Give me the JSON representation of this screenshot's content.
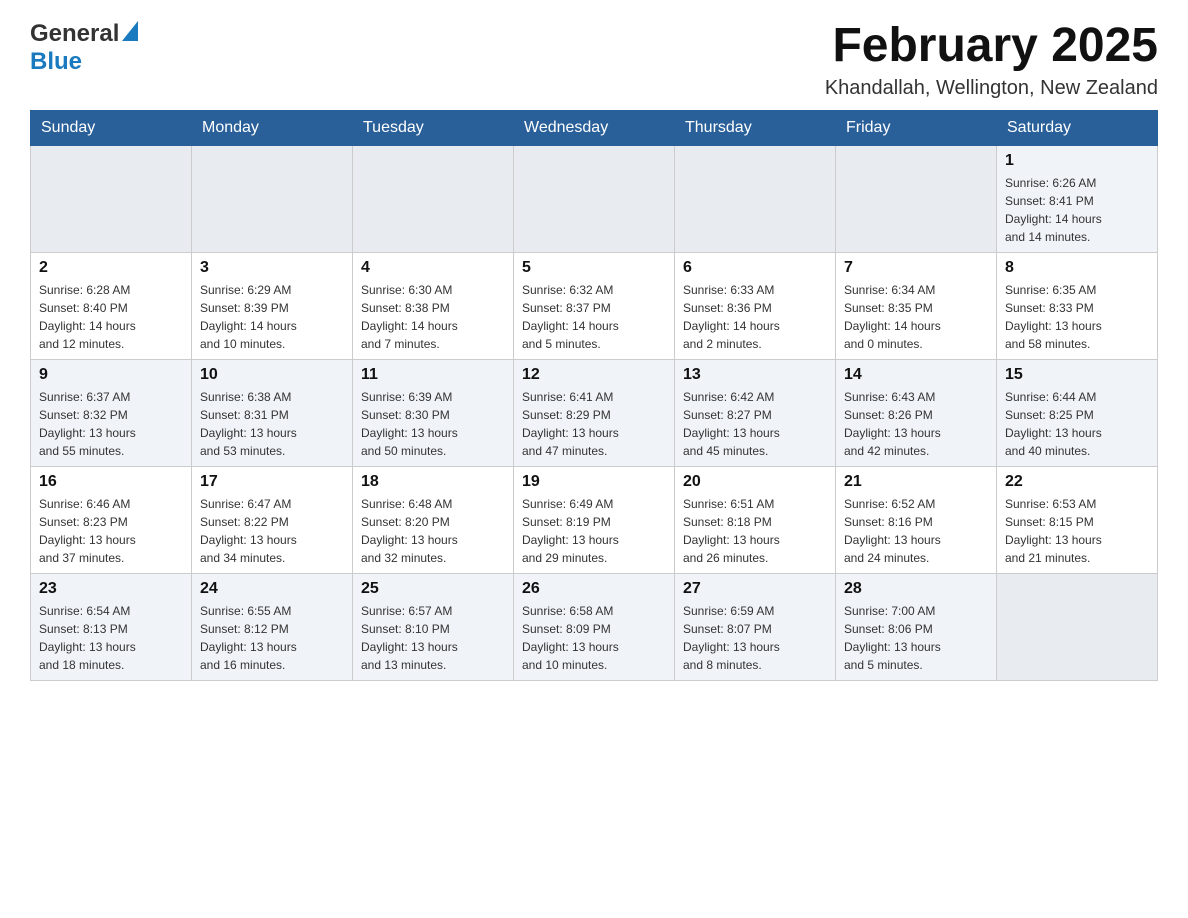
{
  "header": {
    "logo_general": "General",
    "logo_blue": "Blue",
    "title": "February 2025",
    "subtitle": "Khandallah, Wellington, New Zealand"
  },
  "days_of_week": [
    "Sunday",
    "Monday",
    "Tuesday",
    "Wednesday",
    "Thursday",
    "Friday",
    "Saturday"
  ],
  "weeks": [
    {
      "row_class": "row1",
      "days": [
        {
          "number": "",
          "info": ""
        },
        {
          "number": "",
          "info": ""
        },
        {
          "number": "",
          "info": ""
        },
        {
          "number": "",
          "info": ""
        },
        {
          "number": "",
          "info": ""
        },
        {
          "number": "",
          "info": ""
        },
        {
          "number": "1",
          "info": "Sunrise: 6:26 AM\nSunset: 8:41 PM\nDaylight: 14 hours\nand 14 minutes."
        }
      ]
    },
    {
      "row_class": "row2",
      "days": [
        {
          "number": "2",
          "info": "Sunrise: 6:28 AM\nSunset: 8:40 PM\nDaylight: 14 hours\nand 12 minutes."
        },
        {
          "number": "3",
          "info": "Sunrise: 6:29 AM\nSunset: 8:39 PM\nDaylight: 14 hours\nand 10 minutes."
        },
        {
          "number": "4",
          "info": "Sunrise: 6:30 AM\nSunset: 8:38 PM\nDaylight: 14 hours\nand 7 minutes."
        },
        {
          "number": "5",
          "info": "Sunrise: 6:32 AM\nSunset: 8:37 PM\nDaylight: 14 hours\nand 5 minutes."
        },
        {
          "number": "6",
          "info": "Sunrise: 6:33 AM\nSunset: 8:36 PM\nDaylight: 14 hours\nand 2 minutes."
        },
        {
          "number": "7",
          "info": "Sunrise: 6:34 AM\nSunset: 8:35 PM\nDaylight: 14 hours\nand 0 minutes."
        },
        {
          "number": "8",
          "info": "Sunrise: 6:35 AM\nSunset: 8:33 PM\nDaylight: 13 hours\nand 58 minutes."
        }
      ]
    },
    {
      "row_class": "row3",
      "days": [
        {
          "number": "9",
          "info": "Sunrise: 6:37 AM\nSunset: 8:32 PM\nDaylight: 13 hours\nand 55 minutes."
        },
        {
          "number": "10",
          "info": "Sunrise: 6:38 AM\nSunset: 8:31 PM\nDaylight: 13 hours\nand 53 minutes."
        },
        {
          "number": "11",
          "info": "Sunrise: 6:39 AM\nSunset: 8:30 PM\nDaylight: 13 hours\nand 50 minutes."
        },
        {
          "number": "12",
          "info": "Sunrise: 6:41 AM\nSunset: 8:29 PM\nDaylight: 13 hours\nand 47 minutes."
        },
        {
          "number": "13",
          "info": "Sunrise: 6:42 AM\nSunset: 8:27 PM\nDaylight: 13 hours\nand 45 minutes."
        },
        {
          "number": "14",
          "info": "Sunrise: 6:43 AM\nSunset: 8:26 PM\nDaylight: 13 hours\nand 42 minutes."
        },
        {
          "number": "15",
          "info": "Sunrise: 6:44 AM\nSunset: 8:25 PM\nDaylight: 13 hours\nand 40 minutes."
        }
      ]
    },
    {
      "row_class": "row4",
      "days": [
        {
          "number": "16",
          "info": "Sunrise: 6:46 AM\nSunset: 8:23 PM\nDaylight: 13 hours\nand 37 minutes."
        },
        {
          "number": "17",
          "info": "Sunrise: 6:47 AM\nSunset: 8:22 PM\nDaylight: 13 hours\nand 34 minutes."
        },
        {
          "number": "18",
          "info": "Sunrise: 6:48 AM\nSunset: 8:20 PM\nDaylight: 13 hours\nand 32 minutes."
        },
        {
          "number": "19",
          "info": "Sunrise: 6:49 AM\nSunset: 8:19 PM\nDaylight: 13 hours\nand 29 minutes."
        },
        {
          "number": "20",
          "info": "Sunrise: 6:51 AM\nSunset: 8:18 PM\nDaylight: 13 hours\nand 26 minutes."
        },
        {
          "number": "21",
          "info": "Sunrise: 6:52 AM\nSunset: 8:16 PM\nDaylight: 13 hours\nand 24 minutes."
        },
        {
          "number": "22",
          "info": "Sunrise: 6:53 AM\nSunset: 8:15 PM\nDaylight: 13 hours\nand 21 minutes."
        }
      ]
    },
    {
      "row_class": "row5",
      "days": [
        {
          "number": "23",
          "info": "Sunrise: 6:54 AM\nSunset: 8:13 PM\nDaylight: 13 hours\nand 18 minutes."
        },
        {
          "number": "24",
          "info": "Sunrise: 6:55 AM\nSunset: 8:12 PM\nDaylight: 13 hours\nand 16 minutes."
        },
        {
          "number": "25",
          "info": "Sunrise: 6:57 AM\nSunset: 8:10 PM\nDaylight: 13 hours\nand 13 minutes."
        },
        {
          "number": "26",
          "info": "Sunrise: 6:58 AM\nSunset: 8:09 PM\nDaylight: 13 hours\nand 10 minutes."
        },
        {
          "number": "27",
          "info": "Sunrise: 6:59 AM\nSunset: 8:07 PM\nDaylight: 13 hours\nand 8 minutes."
        },
        {
          "number": "28",
          "info": "Sunrise: 7:00 AM\nSunset: 8:06 PM\nDaylight: 13 hours\nand 5 minutes."
        },
        {
          "number": "",
          "info": ""
        }
      ]
    }
  ]
}
